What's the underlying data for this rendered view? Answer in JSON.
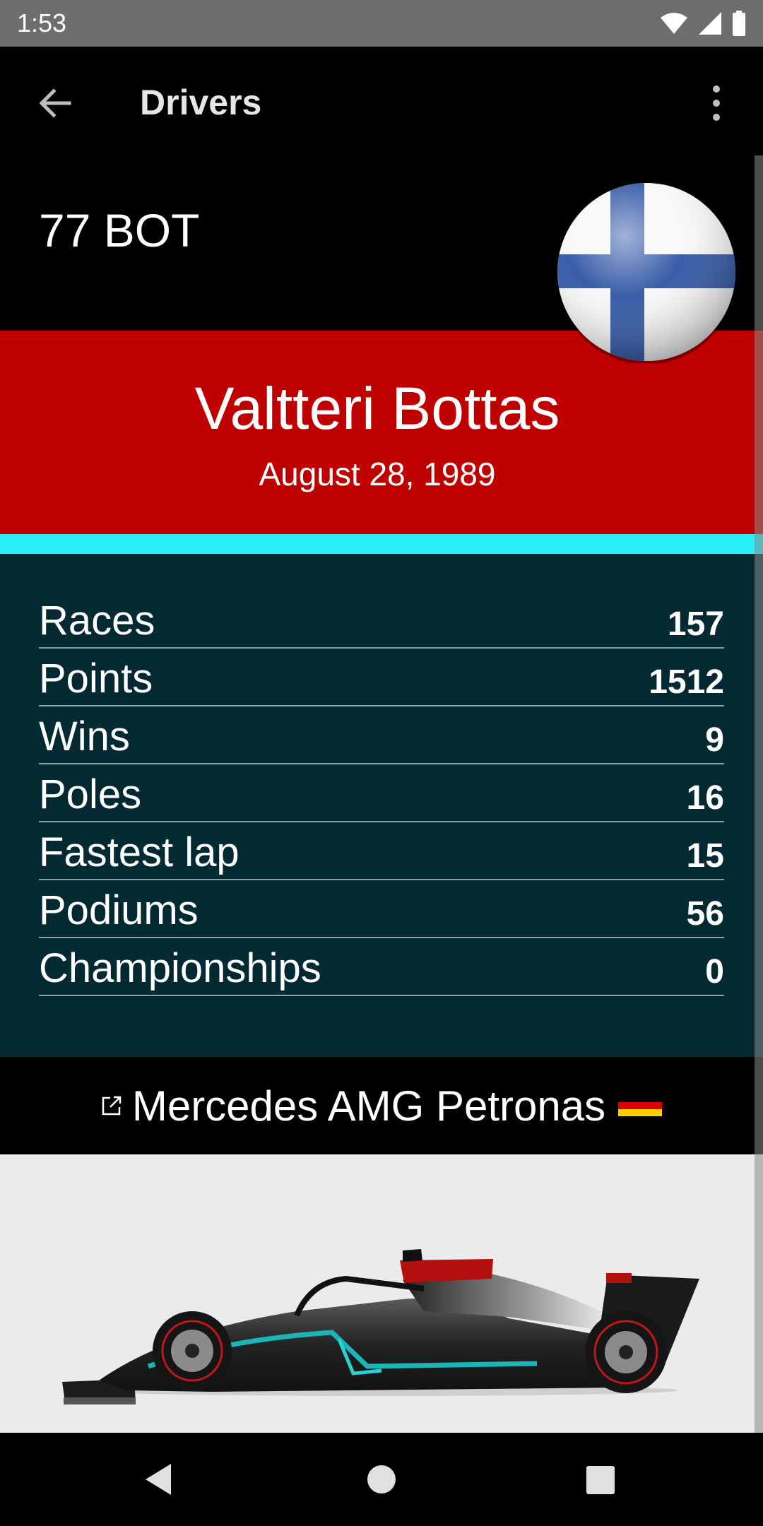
{
  "status_bar": {
    "time": "1:53"
  },
  "app_bar": {
    "title": "Drivers"
  },
  "driver": {
    "code": "77 BOT",
    "name": "Valtteri Bottas",
    "dob": "August 28, 1989",
    "nationality_flag": "finland-flag-icon"
  },
  "stats": [
    {
      "label": "Races",
      "value": "157"
    },
    {
      "label": "Points",
      "value": "1512"
    },
    {
      "label": "Wins",
      "value": "9"
    },
    {
      "label": "Poles",
      "value": "16"
    },
    {
      "label": "Fastest lap",
      "value": "15"
    },
    {
      "label": "Podiums",
      "value": "56"
    },
    {
      "label": "Championships",
      "value": "0"
    }
  ],
  "team": {
    "name": "Mercedes AMG Petronas",
    "flag": "germany-flag-icon",
    "link_icon": "external-link-icon"
  },
  "colors": {
    "name_band": "#bf0000",
    "team_stripe": "#26f0f5",
    "stats_bg": "#032932",
    "car_bg": "#ebebeb"
  }
}
